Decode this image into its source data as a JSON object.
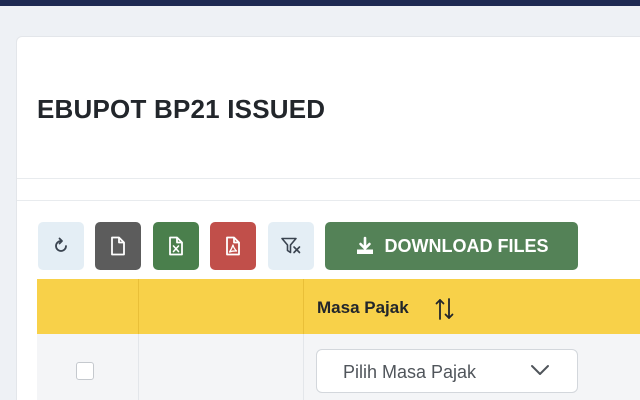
{
  "page": {
    "title": "EBUPOT BP21 ISSUED"
  },
  "toolbar": {
    "refresh_icon": "refresh-icon",
    "file_icon": "file-icon",
    "excel_icon": "excel-icon",
    "pdf_icon": "pdf-icon",
    "filter_icon": "filter-clear-icon",
    "download_label": "DOWNLOAD FILES",
    "download_icon": "download-icon"
  },
  "colors": {
    "header_bg": "#f8d149",
    "download_bg": "#548257",
    "excel_bg": "#4a7f4c",
    "pdf_bg": "#c14f4a",
    "file_bg": "#5c5c5c",
    "light_btn_bg": "#e4eef5"
  },
  "table": {
    "columns": [
      "",
      "",
      "Masa Pajak"
    ],
    "sort_icon": "sort-icon",
    "filter_row": {
      "masa_pajak_placeholder": "Pilih Masa Pajak"
    }
  }
}
